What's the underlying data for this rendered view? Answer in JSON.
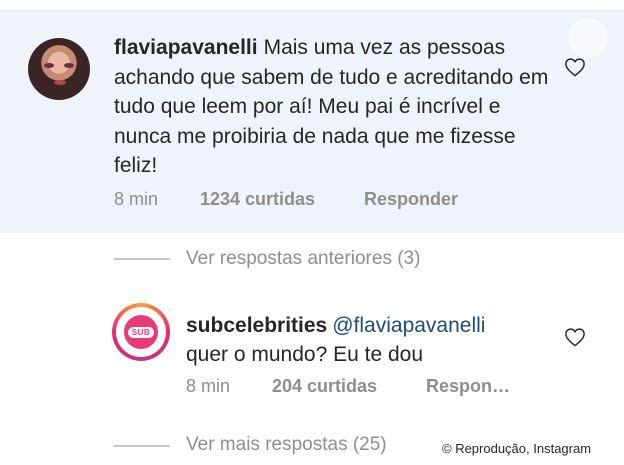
{
  "comment": {
    "username": "flaviapavanelli",
    "text": "Mais uma vez as pessoas achando que sabem de tudo e acreditando em tudo que leem por aí! Meu pai é incrível e nunca me proibiria de nada que me fizesse feliz!",
    "time": "8 min",
    "likes": "1234 curtidas",
    "reply_label": "Responder"
  },
  "view_previous_replies": "Ver respostas anteriores (3)",
  "reply": {
    "username": "subcelebrities",
    "mention": "@flaviapavanelli",
    "text": "quer o mundo? Eu te dou",
    "time": "8 min",
    "likes": "204 curtidas",
    "reply_label": "Respon…",
    "avatar_badge": "SUB"
  },
  "view_more_replies": "Ver mais respostas (25)",
  "credit": "© Reprodução, Instagram",
  "colors": {
    "highlight_bg": "#eff4fb",
    "mention": "#1e4b78",
    "muted": "#8e8e8e"
  }
}
